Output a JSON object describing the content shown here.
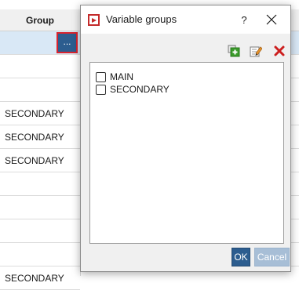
{
  "grid": {
    "column_header": "Group",
    "ellipsis_label": "...",
    "rows": [
      "",
      "",
      "",
      "SECONDARY",
      "SECONDARY",
      "SECONDARY",
      "",
      "",
      "",
      "",
      "SECONDARY"
    ]
  },
  "dialog": {
    "title": "Variable groups",
    "help_label": "?",
    "toolbar": {
      "add_icon": "add-group-icon",
      "edit_icon": "edit-group-icon",
      "delete_icon": "delete-group-icon"
    },
    "groups": [
      {
        "label": "MAIN",
        "checked": false
      },
      {
        "label": "SECONDARY",
        "checked": false
      }
    ],
    "ok_label": "OK",
    "cancel_label": "Cancel"
  },
  "colors": {
    "accent": "#2c5d8f",
    "highlight_border": "#d9232e",
    "delete_red": "#cc1f1f",
    "add_green": "#3a9b2a",
    "selection": "#d9e8f6"
  }
}
